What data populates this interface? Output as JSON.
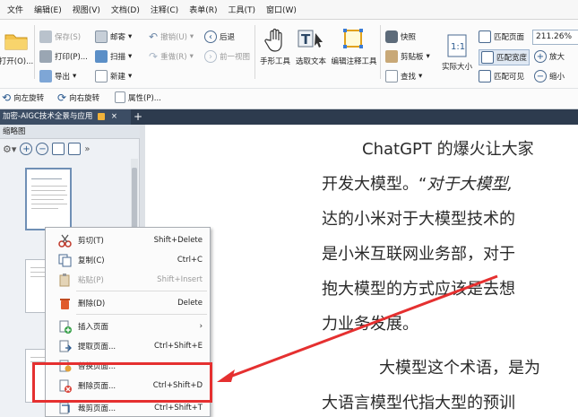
{
  "menubar": {
    "items": [
      "文件",
      "编辑(E)",
      "视图(V)",
      "文档(D)",
      "注释(C)",
      "表单(R)",
      "工具(T)",
      "窗口(W)"
    ]
  },
  "ribbon": {
    "open_label": "打开(O)...",
    "save_label": "保存(S)",
    "print_label": "打印(P)...",
    "export_label": "导出",
    "mail_label": "邮寄",
    "scan_label": "扫描",
    "new_label": "新建",
    "undo_label": "撤销(U)",
    "redo_label": "重做(R)",
    "back_label": "后退",
    "forward_label": "前一视图",
    "hand_tool_label": "手形工具",
    "select_text_label": "选取文本",
    "edit_annot_label": "编辑注释工具",
    "snapshot_label": "快照",
    "clipboard_label": "剪贴板",
    "find_label": "查找",
    "actual_size_label": "实际大小",
    "fit_page_label": "匹配页面",
    "fit_width_label": "匹配宽度",
    "fit_visible_label": "匹配可见",
    "zoom_value": "211.26%",
    "zoom_in_label": "放大",
    "zoom_out_label": "缩小",
    "rotate_left_label": "向左旋转",
    "rotate_right_label": "向右旋转",
    "properties_label": "属性(P)..."
  },
  "tabbar": {
    "doc_tab_label": "加密-AIGC技术全景与应用"
  },
  "thumbnail_panel": {
    "title": "缩略图"
  },
  "document": {
    "lines": [
      "ChatGPT 的爆火让大家",
      "开发大模型。“",
      "对于大模型,",
      "达的小米对于大模型技术的",
      "是小米互联网业务部，对于",
      "抱大模型的方式应该是去想",
      "力业务发展。",
      "大模型这个术语，是为",
      "大语言模型代指大型的预训"
    ]
  },
  "context_menu": {
    "items": [
      {
        "label": "剪切(T)",
        "shortcut": "Shift+Delete"
      },
      {
        "label": "复制(C)",
        "shortcut": "Ctrl+C"
      },
      {
        "label": "粘贴(P)",
        "shortcut": "Shift+Insert"
      },
      {
        "label": "删除(D)",
        "shortcut": "Delete"
      },
      {
        "label": "插入页面",
        "shortcut": ""
      },
      {
        "label": "提取页面...",
        "shortcut": "Ctrl+Shift+E"
      },
      {
        "label": "替换页面...",
        "shortcut": ""
      },
      {
        "label": "删除页面...",
        "shortcut": "Ctrl+Shift+D"
      },
      {
        "label": "裁剪页面...",
        "shortcut": "Ctrl+Shift+T"
      }
    ],
    "submenu_arrow": "›"
  },
  "colors": {
    "highlight": "#e53030",
    "tabbar": "#2d3b4e",
    "accent": "#2b5a8f"
  }
}
